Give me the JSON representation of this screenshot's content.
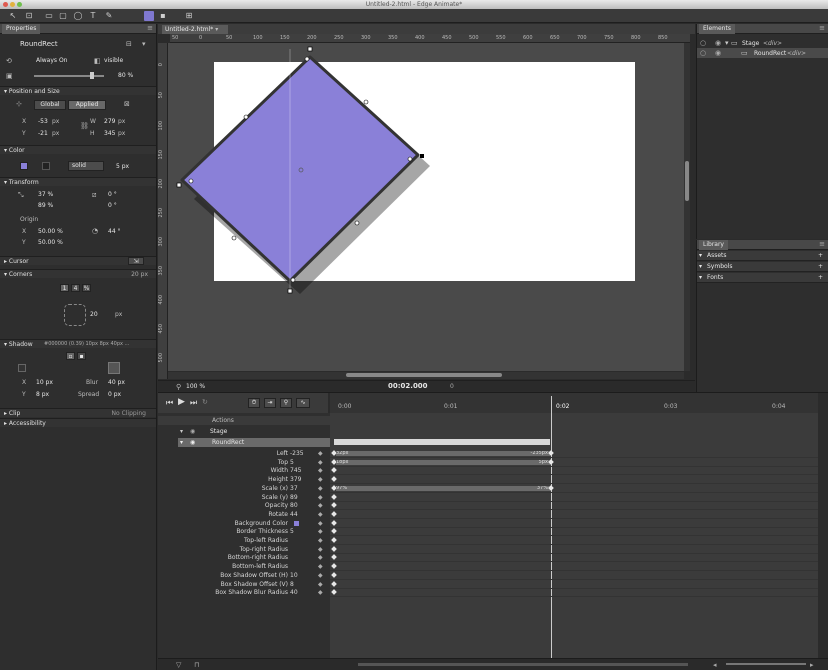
{
  "window": {
    "title": "Untitled-2.html - Edge Animate*"
  },
  "colors": {
    "accent": "#8a80d8",
    "stage": "#ffffff",
    "panel": "#2e2e2e"
  },
  "toolbar": {
    "icons": [
      "select-icon",
      "transform-icon",
      "rectangle-icon",
      "rounded-rect-icon",
      "ellipse-icon",
      "text-icon",
      "stage-icon",
      "clipping-icon"
    ]
  },
  "properties": {
    "tab": "Properties",
    "element_name": "RoundRect",
    "always_on": "Always On",
    "visible": "visible",
    "opacity_value": "80 %",
    "position_section": "Position and Size",
    "global_btn": "Global",
    "applied_btn": "Applied",
    "x_label": "X",
    "x_value": "-53",
    "x_unit": "px",
    "y_label": "Y",
    "y_value": "-21",
    "y_unit": "px",
    "w_label": "W",
    "w_value": "279",
    "w_unit": "px",
    "h_label": "H",
    "h_value": "345",
    "h_unit": "px",
    "color_section": "Color",
    "border_style": "solid",
    "border_width": "5 px",
    "transform_section": "Transform",
    "scale_x": "37 %",
    "scale_y": "89 %",
    "skew_x": "0 °",
    "skew_y": "0 °",
    "origin_label": "Origin",
    "origin_x": "50.00 %",
    "origin_y": "50.00 %",
    "rotate": "44 °",
    "cursor_section": "Cursor",
    "corners_section": "Corners",
    "corners_value": "20 px",
    "corner_btns": [
      "1",
      "4",
      "%"
    ],
    "corner_radius": "20",
    "corner_unit": "px",
    "shadow_section": "Shadow",
    "shadow_value": "#000000 (0.39) 10px 8px 40px ...",
    "shadow_x": "10 px",
    "shadow_y": "8 px",
    "blur_label": "Blur",
    "blur_value": "40 px",
    "spread_label": "Spread",
    "spread_value": "0 px",
    "clip_section": "Clip",
    "clip_value": "No Clipping",
    "accessibility_section": "Accessibility"
  },
  "document": {
    "tab": "Untitled-2.html*",
    "ruler_ticks": [
      "50",
      "0",
      "50",
      "100",
      "150",
      "200",
      "250",
      "300",
      "350",
      "400",
      "450",
      "500",
      "550",
      "600",
      "650",
      "700",
      "750",
      "800",
      "850"
    ],
    "vruler_ticks": [
      "0",
      "50",
      "100",
      "150",
      "200",
      "250",
      "300",
      "350",
      "400",
      "450",
      "500"
    ],
    "zoom": "100 %",
    "time": "00:02.000",
    "time_end": "0"
  },
  "elements": {
    "tab": "Elements",
    "stage_name": "Stage",
    "stage_tag": "<div>",
    "child_name": "RoundRect",
    "child_tag": "<div>"
  },
  "library": {
    "tab": "Library",
    "sections": [
      "Assets",
      "Symbols",
      "Fonts"
    ]
  },
  "timeline": {
    "ticks": [
      "0:00",
      "0:01",
      "0:02",
      "0:03",
      "0:04"
    ],
    "playhead": "0:02",
    "actions_label": "Actions",
    "stage_row": "Stage",
    "element_row": "RoundRect",
    "properties": [
      {
        "name": "Left",
        "value": "-235"
      },
      {
        "name": "Top",
        "value": "5"
      },
      {
        "name": "Width",
        "value": "745"
      },
      {
        "name": "Height",
        "value": "379"
      },
      {
        "name": "Scale (x)",
        "value": "37"
      },
      {
        "name": "Scale (y)",
        "value": "89"
      },
      {
        "name": "Opacity",
        "value": "80"
      },
      {
        "name": "Rotate",
        "value": "44"
      },
      {
        "name": "Background Color",
        "value": ""
      },
      {
        "name": "Border Thickness",
        "value": "5"
      },
      {
        "name": "Top-left Radius",
        "value": ""
      },
      {
        "name": "Top-right Radius",
        "value": ""
      },
      {
        "name": "Bottom-right Radius",
        "value": ""
      },
      {
        "name": "Bottom-left Radius",
        "value": ""
      },
      {
        "name": "Box Shadow Offset (H)",
        "value": "10"
      },
      {
        "name": "Box Shadow Offset (V)",
        "value": "8"
      },
      {
        "name": "Box Shadow Blur Radius",
        "value": "40"
      }
    ],
    "left_bar_start": "32px",
    "left_bar_end": "-235px",
    "top_bar_start": "18px",
    "top_bar_end": "5px",
    "scale_bar_start": "97%",
    "scale_bar_end": "37%"
  }
}
